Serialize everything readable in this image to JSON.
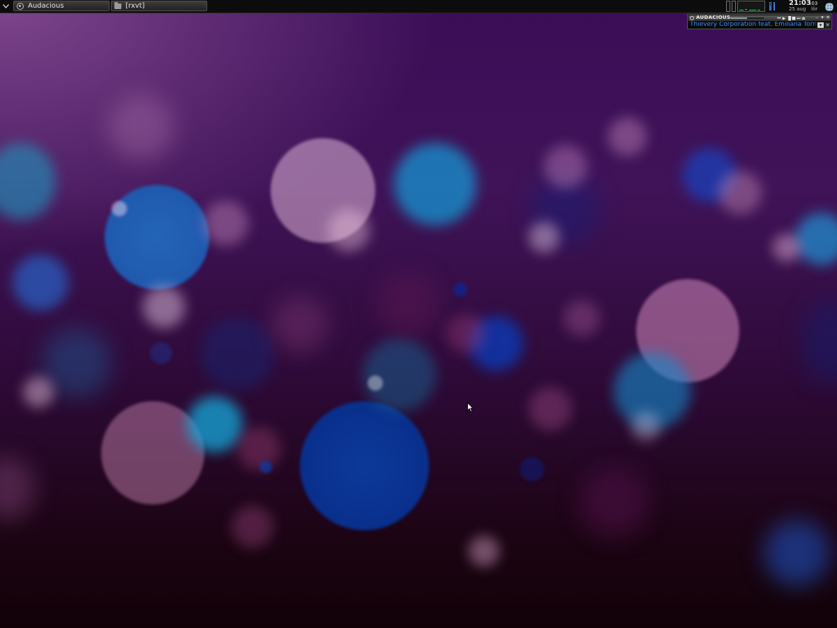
{
  "taskbar": {
    "menu_icon": "chevron-down-icon",
    "tasks": [
      {
        "label": "Audacious",
        "icon": "audacious-icon"
      },
      {
        "label": "[rxvt]",
        "icon": "folder-icon"
      }
    ]
  },
  "tray": {
    "clock": {
      "time": "21:03",
      "seconds": ":03",
      "date": "25 aug",
      "day": "lör"
    },
    "widgets": [
      "cpu-graph",
      "network-graph",
      "memory-meter",
      "tray-app-icon"
    ]
  },
  "player": {
    "app_name": "AUDACIOUS",
    "now_playing": "Thievery Corporation feat. Emiliana Torrini",
    "controls": [
      "prev",
      "play",
      "pause",
      "stop",
      "next",
      "eject"
    ]
  },
  "colors": {
    "panel_bg": "#0c0c0c",
    "song_text": "#3d8fff",
    "net_graph": "#2ed35a"
  }
}
